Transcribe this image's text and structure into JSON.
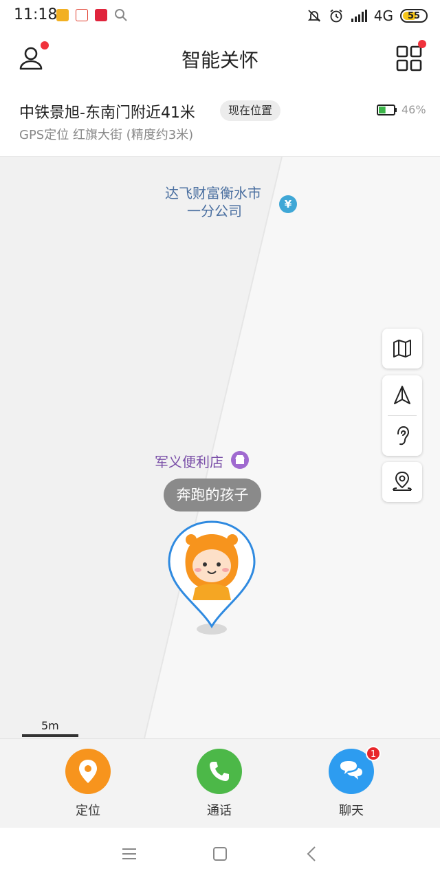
{
  "status_bar": {
    "time": "11:18",
    "network": "4G",
    "battery_level": "55",
    "app_icon_colors": [
      "#f2b022",
      "#e03c2c",
      "#e0243c"
    ]
  },
  "header": {
    "title": "智能关怀",
    "profile_icon": "user-icon",
    "grid_icon": "grid-icon"
  },
  "location_card": {
    "address": "中铁景旭-东南门附近41米",
    "chip_label": "现在位置",
    "detail": "GPS定位  红旗大街  (精度约3米)",
    "battery_percent": "46%",
    "battery_fill": 0.46
  },
  "map": {
    "poi_finance_line1": "达飞财富衡水市",
    "poi_finance_line2": "一分公司",
    "poi_finance_symbol": "¥",
    "poi_store": "军义便利店",
    "child_name": "奔跑的孩子",
    "scale": "5m",
    "controls": [
      "map-layers-icon",
      "navigate-icon",
      "listen-icon",
      "location-history-icon"
    ]
  },
  "actions": [
    {
      "label": "定位",
      "color": "#f7941d",
      "icon": "location-pin-icon"
    },
    {
      "label": "通话",
      "color": "#4cb848",
      "icon": "phone-icon"
    },
    {
      "label": "聊天",
      "color": "#2d9cf0",
      "icon": "chat-icon",
      "badge": "1"
    }
  ],
  "nav": [
    "menu-icon",
    "home-icon",
    "back-icon"
  ]
}
